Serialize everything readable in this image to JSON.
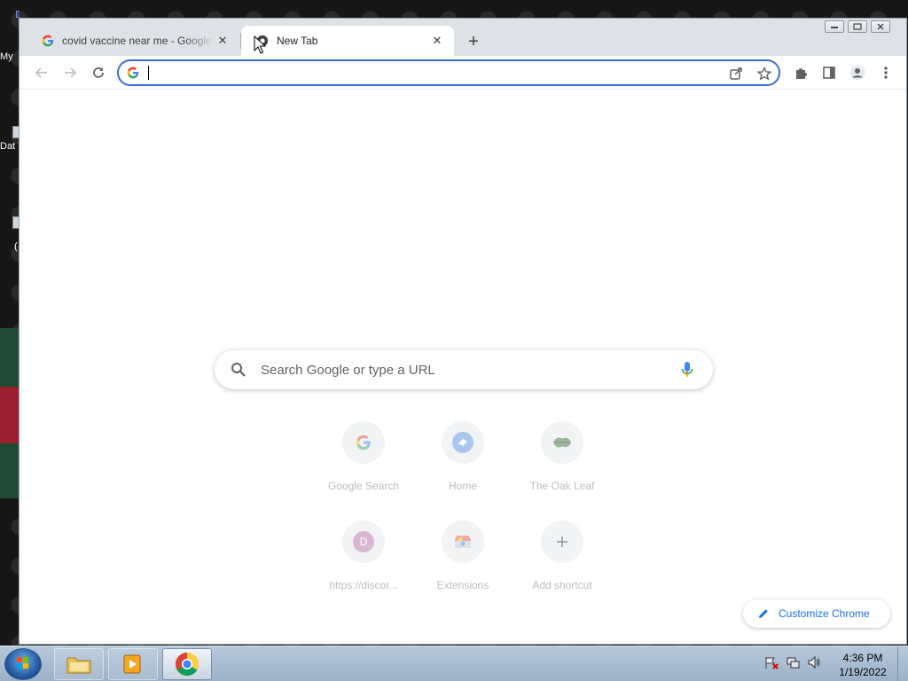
{
  "desktop": {
    "icons": [
      {
        "label": "My"
      },
      {
        "label": "Dat"
      },
      {
        "label": "("
      }
    ],
    "stripe_colors": [
      "#1f4a33",
      "#9a1d30",
      "#1f4a33"
    ]
  },
  "browser": {
    "tabs": [
      {
        "title": "covid vaccine near me - Google Search",
        "favicon": "google-g-icon",
        "active": false
      },
      {
        "title": "New Tab",
        "favicon": "chrome-newtab-icon",
        "active": true
      }
    ],
    "new_tab_label": "+",
    "omnibox": {
      "value": "",
      "placeholder": ""
    },
    "accent_color": "#1a73e8"
  },
  "ntp": {
    "search_placeholder": "Search Google or type a URL",
    "shortcuts": [
      {
        "label": "Google Search",
        "icon": "google-g-icon"
      },
      {
        "label": "Home",
        "icon": "home-ticket-icon"
      },
      {
        "label": "The Oak Leaf",
        "icon": "oak-leaf-icon"
      },
      {
        "label": "https://discor...",
        "icon": "letter-d-icon",
        "letter": "D"
      },
      {
        "label": "Extensions",
        "icon": "chrome-web-store-icon"
      },
      {
        "label": "Add shortcut",
        "icon": "plus-icon"
      }
    ],
    "customize_label": "Customize Chrome"
  },
  "taskbar": {
    "clock_time": "4:36 PM",
    "clock_date": "1/19/2022"
  }
}
